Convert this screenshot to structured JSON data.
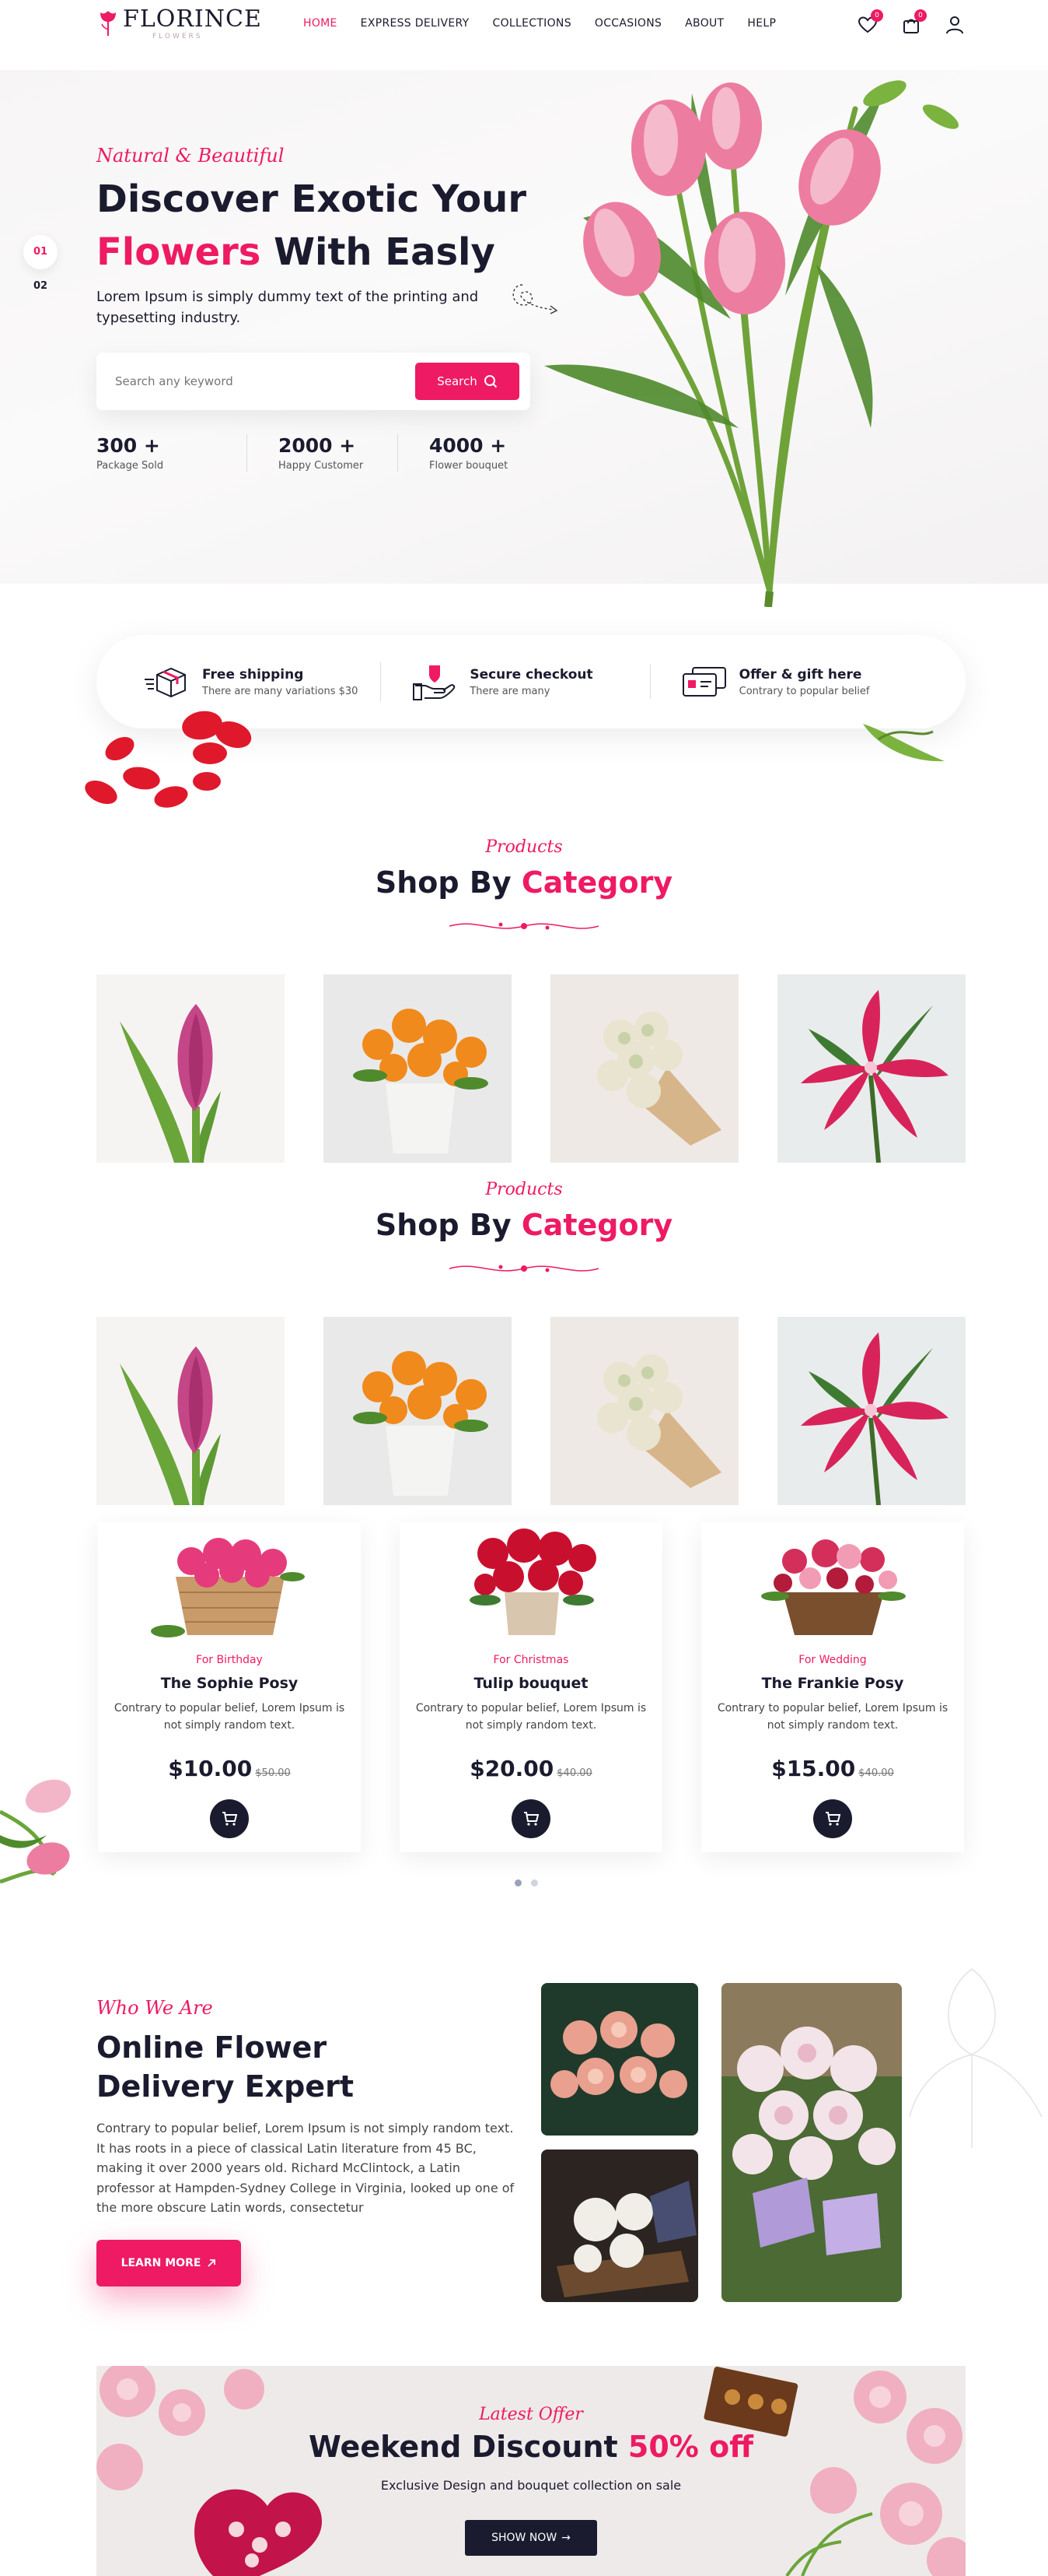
{
  "header": {
    "logo_title": "FLORINCE",
    "logo_sub": "FLOWERS",
    "nav": [
      {
        "label": "HOME",
        "active": true
      },
      {
        "label": "EXPRESS DELIVERY"
      },
      {
        "label": "COLLECTIONS"
      },
      {
        "label": "OCCASIONS"
      },
      {
        "label": "ABOUT"
      },
      {
        "label": "HELP"
      }
    ],
    "wishlist_count": "0",
    "cart_count": "0",
    "icons": [
      "heart-icon",
      "bag-icon",
      "user-icon"
    ]
  },
  "hero": {
    "slides": [
      "01",
      "02"
    ],
    "kicker": "Natural & Beautiful",
    "title_line1": "Discover Exotic Your",
    "title_accent": "Flowers",
    "title_rest": " With Easly",
    "description": "Lorem Ipsum is simply dummy text of the printing and typesetting industry.",
    "search_placeholder": "Search any keyword",
    "search_button": "Search",
    "stats": [
      {
        "value": "300 +",
        "label": "Package Sold"
      },
      {
        "value": "2000 +",
        "label": "Happy Customer"
      },
      {
        "value": "4000 +",
        "label": "Flower bouquet"
      }
    ]
  },
  "features": [
    {
      "title": "Free shipping",
      "subtitle": "There are many variations $30",
      "icon": "shipping-box-icon"
    },
    {
      "title": "Secure checkout",
      "subtitle": "There are many",
      "icon": "secure-hand-icon"
    },
    {
      "title": "Offer & gift here",
      "subtitle": "Contrary to popular belief",
      "icon": "gift-card-icon"
    }
  ],
  "category_sections": [
    {
      "kicker": "Products",
      "title_main": "Shop By ",
      "title_accent": "Category"
    },
    {
      "kicker": "Products",
      "title_main": "Shop By ",
      "title_accent": "Category"
    }
  ],
  "products": [
    {
      "category": "For Birthday",
      "name": "The Sophie Posy",
      "description": "Contrary to popular belief, Lorem Ipsum is not simply random text.",
      "price": "$10.00",
      "old_price": "$50.00"
    },
    {
      "category": "For Christmas",
      "name": "Tulip bouquet",
      "description": "Contrary to popular belief, Lorem Ipsum is not simply random text.",
      "price": "$20.00",
      "old_price": "$40.00"
    },
    {
      "category": "For Wedding",
      "name": "The Frankie Posy",
      "description": "Contrary to popular belief, Lorem Ipsum is not simply random text.",
      "price": "$15.00",
      "old_price": "$40.00"
    }
  ],
  "about": {
    "kicker": "Who We Are",
    "title_line1": "Online Flower",
    "title_line2": "Delivery Expert",
    "text": "Contrary to popular belief, Lorem Ipsum is not simply random text. It has roots in a piece of classical Latin literature from 45 BC, making it over 2000 years old. Richard McClintock, a Latin professor at Hampden-Sydney College in Virginia, looked up one of the more obscure Latin words, consectetur",
    "button": "LEARN MORE"
  },
  "offer": {
    "kicker": "Latest Offer",
    "title_main": "Weekend Discount ",
    "title_accent": "50% off",
    "subtitle": "Exclusive Design and bouquet collection on sale",
    "button": "SHOW NOW"
  },
  "colors": {
    "accent": "#ee1a63",
    "dark": "#1b1b2f",
    "muted": "#555555"
  }
}
